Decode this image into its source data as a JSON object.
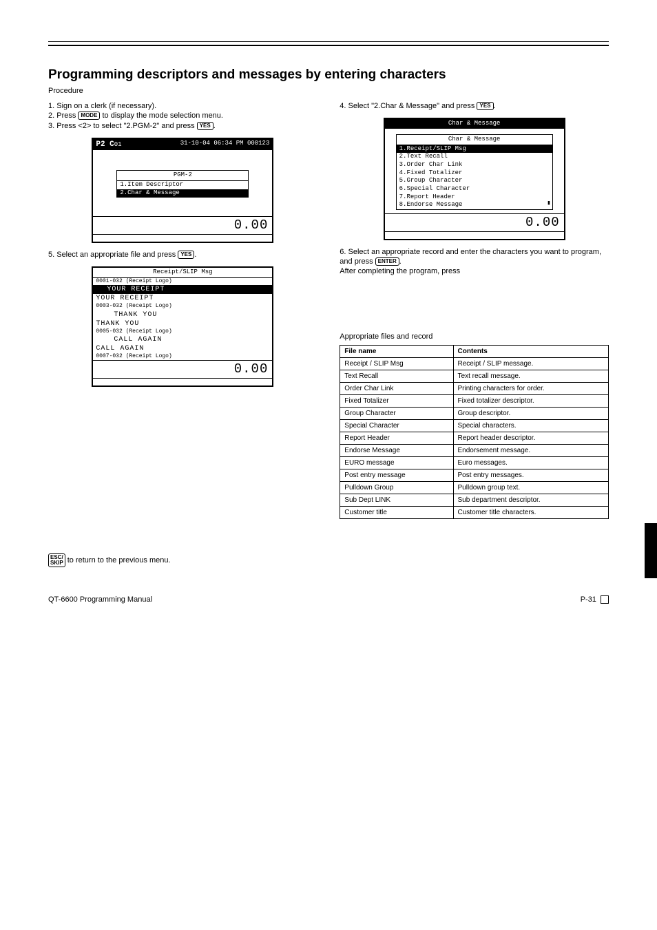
{
  "title": "Programming descriptors and messages by entering characters",
  "subtitle": "Procedure",
  "step1": {
    "prefix": "1. Sign on a clerk (if necessary).",
    "mid": "2. Press",
    "key": "MODE",
    "tail": "to display the mode selection menu."
  },
  "step2": {
    "text": "3. Press <2> to select \"2.PGM-2\" and press",
    "key": "YES",
    "period": "."
  },
  "step3": {
    "text": "4. Select \"2.Char & Message\" and press",
    "key": "YES",
    "period": "."
  },
  "step4": {
    "text": "5. Select an appropriate file and press",
    "key": "YES",
    "period": "."
  },
  "step5": {
    "text": "6. Select an appropriate record and enter the characters you  want to program, and press",
    "key": "ENTER",
    "tail": "After completing the program, press"
  },
  "step6_key": "ESC/\nSKIP",
  "step6_tail": " to return to the previous menu.",
  "screen1": {
    "left": "P2 C",
    "left_small": "01",
    "right": "31-10-04 06:34 PM 000123",
    "menu_title": "PGM-2",
    "item1": "1.Item Descriptor",
    "item2": "2.Char & Message",
    "amount": "0.00"
  },
  "screen2": {
    "title": "Char & Message",
    "menu_title": "Char & Message",
    "items": [
      "1.Receipt/SLIP Msg",
      "2.Text Recall",
      "3.Order Char Link",
      "4.Fixed Totalizer",
      "5.Group Character",
      "6.Special Character",
      "7.Report Header",
      "8.Endorse Message"
    ],
    "amount": "0.00"
  },
  "screen3": {
    "title": "Receipt/SLIP Msg",
    "rows": [
      {
        "label": "0001-032 (Receipt Logo)",
        "val_sel": "YOUR RECEIPT",
        "val": "YOUR RECEIPT"
      },
      {
        "label": "0003-032 (Receipt Logo)",
        "ind": "THANK YOU",
        "val": "THANK YOU"
      },
      {
        "label": "0005-032 (Receipt Logo)",
        "ind": "CALL AGAIN",
        "val": "CALL AGAIN"
      },
      {
        "label": "0007-032 (Receipt Logo)"
      }
    ],
    "amount": "0.00"
  },
  "index_heading": "Appropriate files and record",
  "index": [
    {
      "file": "Receipt / SLIP Msg",
      "contents": "Receipt / SLIP message."
    },
    {
      "file": "Text Recall",
      "contents": "Text recall message."
    },
    {
      "file": "Order Char Link",
      "contents": "Printing characters for order."
    },
    {
      "file": "Fixed Totalizer",
      "contents": "Fixed totalizer descriptor."
    },
    {
      "file": "Group Character",
      "contents": "Group descriptor."
    },
    {
      "file": "Special Character",
      "contents": "Special characters."
    },
    {
      "file": "Report Header",
      "contents": "Report header descriptor."
    },
    {
      "file": "Endorse Message",
      "contents": "Endorsement message."
    },
    {
      "file": "EURO message",
      "contents": "Euro messages."
    },
    {
      "file": "Post entry message",
      "contents": "Post entry messages."
    },
    {
      "file": "Pulldown Group",
      "contents": "Pulldown group text."
    },
    {
      "file": "Sub Dept LINK",
      "contents": "Sub department descriptor."
    },
    {
      "file": "Customer title",
      "contents": "Customer title characters."
    }
  ],
  "footer": {
    "model": "QT-6600 Programming Manual",
    "page": "P-31"
  }
}
